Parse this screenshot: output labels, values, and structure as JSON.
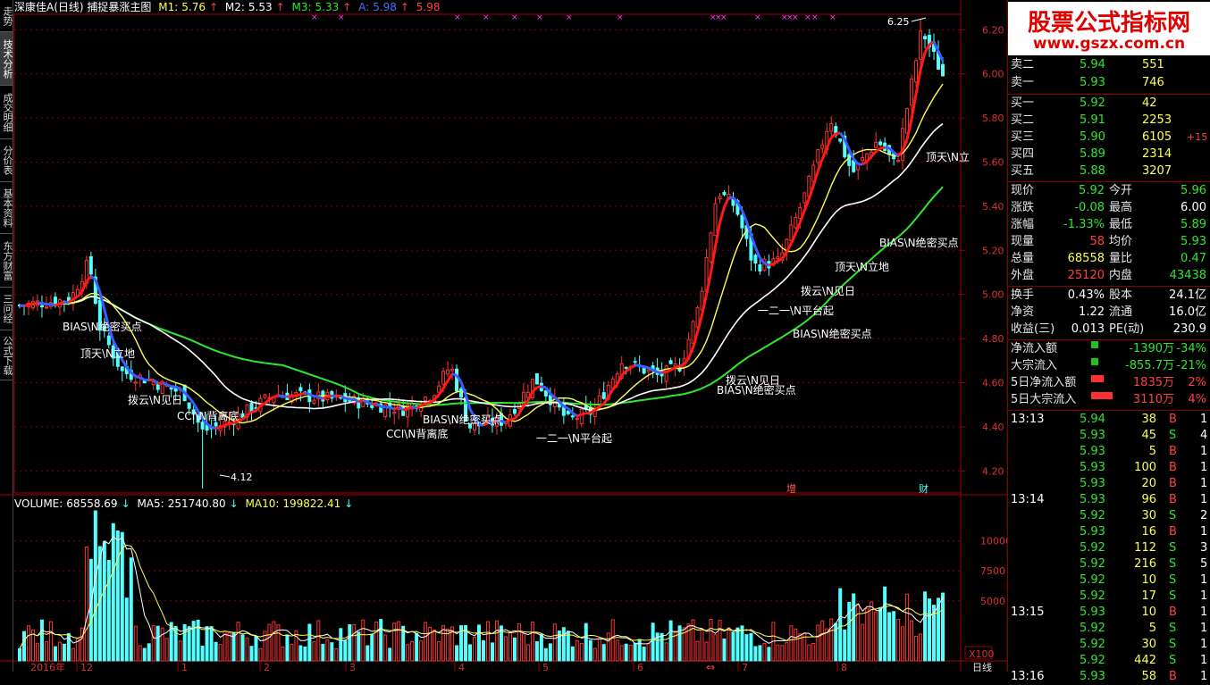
{
  "header": {
    "title": "深康佳A(日线) 捕捉暴涨主图",
    "m1_label": "M1:",
    "m1_value": "5.76",
    "m2_label": "M2:",
    "m2_value": "5.53",
    "m3_label": "M3:",
    "m3_value": "5.33",
    "a_label": "A:",
    "a_value": "5.98",
    "extra_value": "5.98"
  },
  "sidebar": [
    {
      "label": "走势"
    },
    {
      "label": "技术分析"
    },
    {
      "label": "成交明细"
    },
    {
      "label": "分价表"
    },
    {
      "label": "基本资料"
    },
    {
      "label": "东方财富"
    },
    {
      "label": "三问经"
    },
    {
      "label": "公式下载"
    }
  ],
  "price_axis": {
    "ticks": [
      "6.20",
      "6.00",
      "5.80",
      "5.60",
      "5.40",
      "5.20",
      "5.00",
      "4.80",
      "4.60",
      "4.40",
      "4.20"
    ]
  },
  "volume_axis": {
    "ticks": [
      "10000",
      "7500",
      "5000"
    ],
    "unit": "X100"
  },
  "annotations": {
    "high_marker": "6.25",
    "low_marker": "4.12",
    "signals": [
      "BIAS\\N绝密买点",
      "顶天\\N立地",
      "拨云\\N见日",
      "CCI\\N背离底",
      "BIAS\\N绝密买点",
      "CCI\\N背离底",
      "一二一\\N平台起",
      "拨云\\N见日",
      "BIAS\\N绝密买点",
      "BIAS\\N绝密买点",
      "一二一\\N平台起",
      "拨云\\N见日",
      "顶天\\N立地",
      "BIAS\\N绝密买点",
      "顶天\\N立"
    ],
    "event_tags": [
      "增",
      "财"
    ]
  },
  "volume_header": {
    "vol_label": "VOLUME:",
    "vol_value": "68558.69",
    "ma5_label": "MA5:",
    "ma5_value": "251740.80",
    "ma10_label": "MA10:",
    "ma10_value": "199822.41"
  },
  "date_axis": {
    "labels": [
      "2016年",
      "12",
      "1",
      "2",
      "3",
      "4",
      "5",
      "6",
      "7",
      "8"
    ],
    "period": "日线"
  },
  "quote": {
    "brand_cn": "股票公式指标网",
    "brand_url": "www.gszx.com.cn",
    "asks": [
      {
        "label": "卖二",
        "price": "5.94",
        "vol": "551"
      },
      {
        "label": "卖一",
        "price": "5.93",
        "vol": "746"
      }
    ],
    "bids": [
      {
        "label": "买一",
        "price": "5.92",
        "vol": "42",
        "chg": ""
      },
      {
        "label": "买二",
        "price": "5.91",
        "vol": "2253",
        "chg": ""
      },
      {
        "label": "买三",
        "price": "5.90",
        "vol": "6105",
        "chg": "+15"
      },
      {
        "label": "买四",
        "price": "5.89",
        "vol": "2314",
        "chg": ""
      },
      {
        "label": "买五",
        "price": "5.88",
        "vol": "3207",
        "chg": ""
      }
    ],
    "stats": [
      {
        "l1": "现价",
        "v1": "5.92",
        "l2": "今开",
        "v2": "5.96"
      },
      {
        "l1": "涨跌",
        "v1": "-0.08",
        "l2": "最高",
        "v2": "6.00"
      },
      {
        "l1": "涨幅",
        "v1": "-1.33%",
        "l2": "最低",
        "v2": "5.89"
      },
      {
        "l1": "现量",
        "v1": "58",
        "l2": "均价",
        "v2": "5.93"
      },
      {
        "l1": "总量",
        "v1": "68558",
        "l2": "量比",
        "v2": "0.47"
      },
      {
        "l1": "外盘",
        "v1": "25120",
        "l2": "内盘",
        "v2": "43438"
      }
    ],
    "fundamentals": [
      {
        "l1": "换手",
        "v1": "0.43%",
        "l2": "股本",
        "v2": "24.1亿"
      },
      {
        "l1": "净资",
        "v1": "1.22",
        "l2": "流通",
        "v2": "16.0亿"
      },
      {
        "l1": "收益(三)",
        "v1": "0.013",
        "l2": "PE(动)",
        "v2": "230.9"
      }
    ],
    "flows": [
      {
        "label": "净流入额",
        "value": "-1390万",
        "pct": "-34%"
      },
      {
        "label": "大宗流入",
        "value": "-855.7万",
        "pct": "-21%"
      },
      {
        "label": "5日净流入额",
        "value": "1835万",
        "pct": "2%"
      },
      {
        "label": "5日大宗流入",
        "value": "3110万",
        "pct": "4%"
      }
    ],
    "ticks": [
      {
        "time": "13:13",
        "price": "5.94",
        "vol": "38",
        "side": "B",
        "n": "1"
      },
      {
        "time": "",
        "price": "5.93",
        "vol": "45",
        "side": "S",
        "n": "4"
      },
      {
        "time": "",
        "price": "5.93",
        "vol": "5",
        "side": "B",
        "n": "1"
      },
      {
        "time": "",
        "price": "5.93",
        "vol": "100",
        "side": "B",
        "n": "1"
      },
      {
        "time": "",
        "price": "5.93",
        "vol": "20",
        "side": "B",
        "n": "1"
      },
      {
        "time": "13:14",
        "price": "5.93",
        "vol": "96",
        "side": "B",
        "n": "1"
      },
      {
        "time": "",
        "price": "5.92",
        "vol": "30",
        "side": "S",
        "n": "2"
      },
      {
        "time": "",
        "price": "5.93",
        "vol": "16",
        "side": "B",
        "n": "1"
      },
      {
        "time": "",
        "price": "5.92",
        "vol": "112",
        "side": "S",
        "n": "3"
      },
      {
        "time": "",
        "price": "5.92",
        "vol": "216",
        "side": "S",
        "n": "5"
      },
      {
        "time": "",
        "price": "5.92",
        "vol": "10",
        "side": "S",
        "n": "1"
      },
      {
        "time": "",
        "price": "5.92",
        "vol": "17",
        "side": "S",
        "n": "1"
      },
      {
        "time": "13:15",
        "price": "5.93",
        "vol": "10",
        "side": "B",
        "n": "1"
      },
      {
        "time": "",
        "price": "5.92",
        "vol": "5",
        "side": "S",
        "n": "1"
      },
      {
        "time": "",
        "price": "5.92",
        "vol": "30",
        "side": "S",
        "n": "1"
      },
      {
        "time": "",
        "price": "5.92",
        "vol": "442",
        "side": "S",
        "n": "1"
      },
      {
        "time": "13:16",
        "price": "5.93",
        "vol": "58",
        "side": "B",
        "n": "1"
      }
    ]
  },
  "colors": {
    "up": "#ff3232",
    "down": "#54ffff",
    "m1": "#ffff54",
    "m2": "#ffffff",
    "m3": "#2ee62e",
    "volma5": "#ffffff",
    "volma10": "#ffff54",
    "grid": "#7a0000",
    "axis": "#a00000"
  },
  "chart_data": {
    "type": "candlestick",
    "price_ylim": [
      4.1,
      6.27
    ],
    "high": 6.25,
    "low": 4.12,
    "last_close": 5.92,
    "series_values": {
      "M1": 5.76,
      "M2": 5.53,
      "M3": 5.33,
      "A": 5.98
    },
    "volume_values": {
      "VOLUME": 68558.69,
      "MA5": 251740.8,
      "MA10": 199822.41
    },
    "volume_ylim": [
      0,
      12500
    ]
  }
}
